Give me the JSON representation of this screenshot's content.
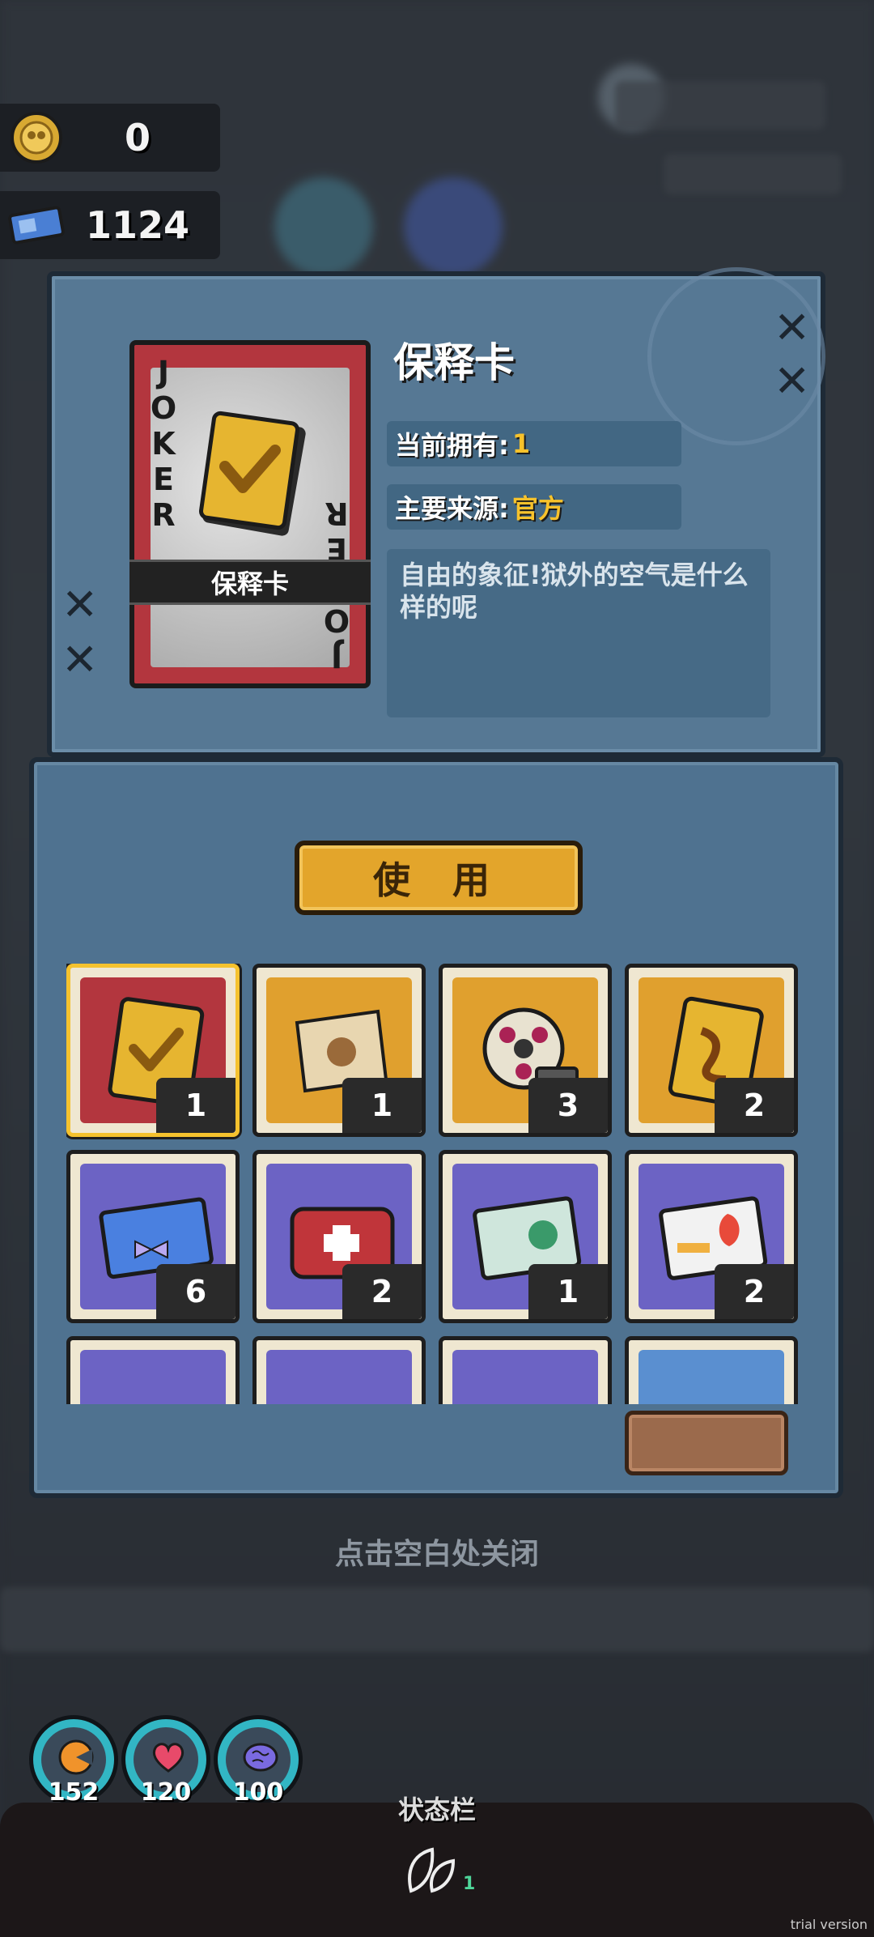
{
  "currency": {
    "coins": "0",
    "tickets": "1124",
    "coin_icon": "coin-icon",
    "ticket_icon": "ticket-icon"
  },
  "item_detail": {
    "card_top_text": "JOKER",
    "card_bottom_text": "JOKER",
    "card_label": "保释卡",
    "title": "保释卡",
    "owned_label": "当前拥有:",
    "owned_value": "1",
    "source_label": "主要来源:",
    "source_value": "官方",
    "description": "自由的象征!狱外的空气是什么样的呢"
  },
  "use_button": "使 用",
  "inventory": [
    {
      "name": "bail-card",
      "count": "1",
      "bg": "#b3363e",
      "selected": true
    },
    {
      "name": "map-scroll",
      "count": "1",
      "bg": "#e0a02e"
    },
    {
      "name": "film-reel",
      "count": "3",
      "bg": "#e0a02e"
    },
    {
      "name": "ribbon-card",
      "count": "2",
      "bg": "#e0a02e"
    },
    {
      "name": "ticket",
      "count": "6",
      "bg": "#6c63c4"
    },
    {
      "name": "first-aid-kit",
      "count": "2",
      "bg": "#6c63c4"
    },
    {
      "name": "game-box",
      "count": "1",
      "bg": "#6c63c4"
    },
    {
      "name": "toy-box",
      "count": "2",
      "bg": "#6c63c4"
    },
    {
      "name": "item-9",
      "count": "",
      "bg": "#6c63c4"
    },
    {
      "name": "item-10",
      "count": "",
      "bg": "#6c63c4"
    },
    {
      "name": "item-11",
      "count": "",
      "bg": "#6c63c4"
    },
    {
      "name": "item-12",
      "count": "",
      "bg": "#5a8fd0"
    }
  ],
  "close_hint": "点击空白处关闭",
  "stats": {
    "hunger": "152",
    "health": "120",
    "sanity": "100"
  },
  "status_bar": {
    "label": "状态栏",
    "count": "1"
  },
  "watermark": "trial version"
}
